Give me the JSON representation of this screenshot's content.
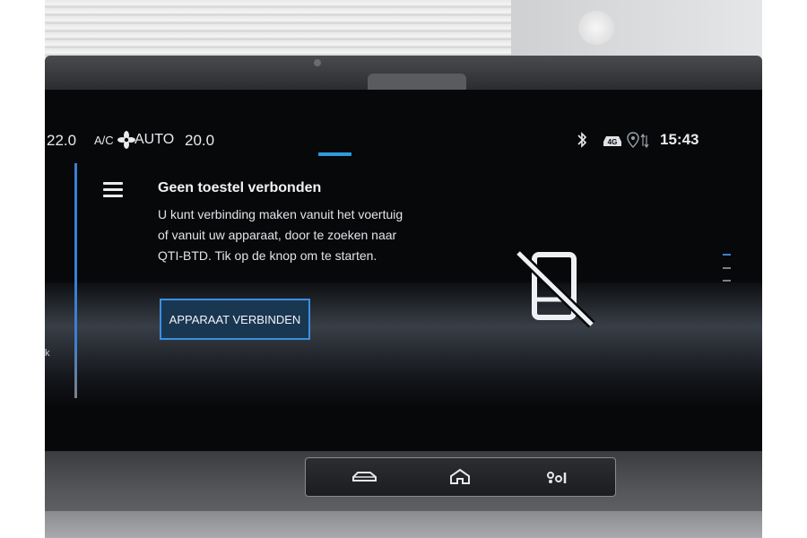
{
  "status_bar": {
    "temp_left": "22.0",
    "ac_label": "A/C",
    "fan_mode": "AUTO",
    "temp_right": "20.0",
    "icons": [
      "bluetooth-icon",
      "4g-car-icon",
      "location-icon",
      "signal-arrows-icon"
    ],
    "network_label": "4G",
    "time": "15:43"
  },
  "left_panel": {
    "partial_text": "k"
  },
  "main": {
    "title": "Geen toestel verbonden",
    "description": "U kunt verbinding maken vanuit het voertuig of vanuit uw apparaat, door te zoeken naar QTI-BTD. Tik op de knop om te starten.",
    "connect_button": "APPARAAT VERBINDEN",
    "status_icon": "phone-disconnected-icon"
  },
  "hardware_buttons": [
    "car-icon",
    "home-icon",
    "drive-mode-icon"
  ],
  "colors": {
    "accent": "#3a90e0",
    "screen_bg": "#07080a",
    "text": "#e8eaee"
  }
}
